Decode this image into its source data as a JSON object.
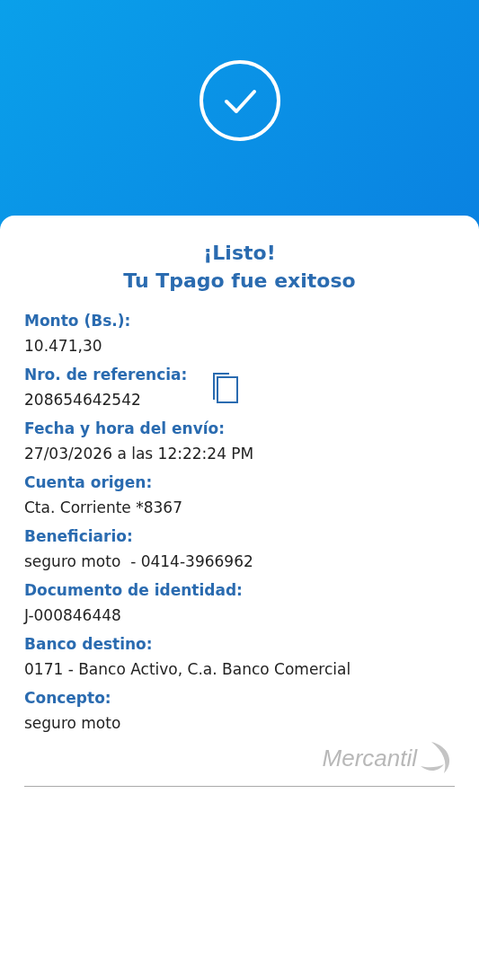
{
  "title": {
    "line_1": "¡Listo!",
    "line_2": "Tu Tpago fue exitoso"
  },
  "fields": [
    {
      "label": "Monto (Bs.):",
      "value": "10.471,30",
      "copyable": false
    },
    {
      "label": "Nro. de referencia:",
      "value": "208654642542",
      "copyable": true
    },
    {
      "label": "Fecha y hora del envío:",
      "value": "27/03/2026 a las 12:22:24 PM",
      "copyable": false
    },
    {
      "label": "Cuenta origen:",
      "value": "Cta. Corriente *8367",
      "copyable": false
    },
    {
      "label": "Beneficiario:",
      "value": "seguro moto  - 0414-3966962",
      "copyable": false
    },
    {
      "label": "Documento de identidad:",
      "value": "J-000846448",
      "copyable": false
    },
    {
      "label": "Banco destino:",
      "value": "0171 - Banco Activo, C.a. Banco Comercial",
      "copyable": false
    },
    {
      "label": "Concepto:",
      "value": "seguro moto",
      "copyable": false
    }
  ],
  "brand": {
    "name": "Mercantil"
  }
}
